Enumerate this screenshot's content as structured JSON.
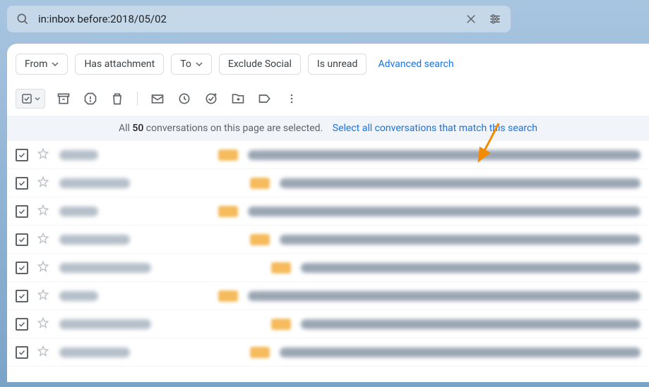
{
  "search": {
    "query": "in:inbox before:2018/05/02"
  },
  "filters": {
    "from": "From",
    "has_attachment": "Has attachment",
    "to": "To",
    "exclude_social": "Exclude Social",
    "is_unread": "Is unread",
    "advanced": "Advanced search"
  },
  "banner": {
    "prefix": "All ",
    "count": "50",
    "suffix": " conversations on this page are selected.",
    "link": "Select all conversations that match this search"
  },
  "rows": [
    {
      "senderW": "w55"
    },
    {
      "senderW": "w100"
    },
    {
      "senderW": "w55"
    },
    {
      "senderW": "w100"
    },
    {
      "senderW": "w130"
    },
    {
      "senderW": "w55"
    },
    {
      "senderW": "w130"
    },
    {
      "senderW": "w100"
    }
  ]
}
